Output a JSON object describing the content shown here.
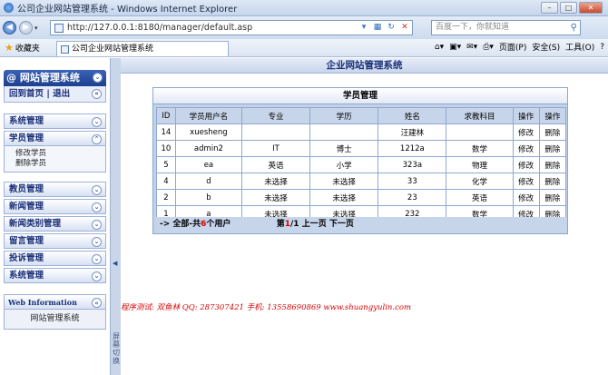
{
  "window": {
    "title": "公司企业网站管理系统 - Windows Internet Explorer",
    "url": "http://127.0.0.1:8180/manager/default.asp",
    "search_placeholder": "百度一下，你就知道"
  },
  "favbar": {
    "favorites_label": "收藏夹",
    "tab_title": "公司企业网站管理系统",
    "page_menu": "页面(P)",
    "safety_menu": "安全(S)",
    "tools_menu": "工具(O)",
    "help_icon": "?"
  },
  "sidebar": {
    "header": "网站管理系统",
    "home_link": "回到首页",
    "sep": "|",
    "logout_link": "退出",
    "menus": [
      {
        "label": "系统管理"
      },
      {
        "label": "学员管理",
        "expanded": true,
        "subitems": [
          "修改学员",
          "删除学员"
        ]
      },
      {
        "label": "教员管理"
      },
      {
        "label": "新闻管理"
      },
      {
        "label": "新闻类别管理"
      },
      {
        "label": "留言管理"
      },
      {
        "label": "投诉管理"
      },
      {
        "label": "系统管理"
      }
    ],
    "web_info_header": "Web Information",
    "web_info_text": "网站管理系统",
    "splitter_text": "屏幕切换"
  },
  "main": {
    "title": "企业网站管理系统",
    "panel_title": "学员管理",
    "columns": [
      "ID",
      "学员用户名",
      "专业",
      "学历",
      "姓名",
      "求教科目",
      "操作",
      "操作"
    ],
    "rows": [
      [
        "14",
        "xuesheng",
        "",
        "",
        "汪建林",
        "",
        "修改",
        "删除"
      ],
      [
        "10",
        "admin2",
        "IT",
        "博士",
        "1212a",
        "数学",
        "修改",
        "删除"
      ],
      [
        "5",
        "ea",
        "英语",
        "小学",
        "323a",
        "物理",
        "修改",
        "删除"
      ],
      [
        "4",
        "d",
        "未选择",
        "未选择",
        "33",
        "化学",
        "修改",
        "删除"
      ],
      [
        "2",
        "b",
        "未选择",
        "未选择",
        "23",
        "英语",
        "修改",
        "删除"
      ],
      [
        "1",
        "a",
        "未选择",
        "未选择",
        "232",
        "数学",
        "修改",
        "删除"
      ]
    ],
    "footer_prefix": "-> 全部-共",
    "footer_count": "6",
    "footer_suffix": "个用户",
    "page_prefix": "第",
    "page_current": "1",
    "page_total": "/1",
    "prev_page": "上一页",
    "next_page": "下一页",
    "credit": "程序测试: 双鱼林  QQ: 287307421  手机: 13558690869  www.shuangyulin.com"
  },
  "colors": {
    "sidebar_header": "#1d3f8f",
    "accent_red": "#d40000",
    "table_header": "#c7d5eb"
  }
}
